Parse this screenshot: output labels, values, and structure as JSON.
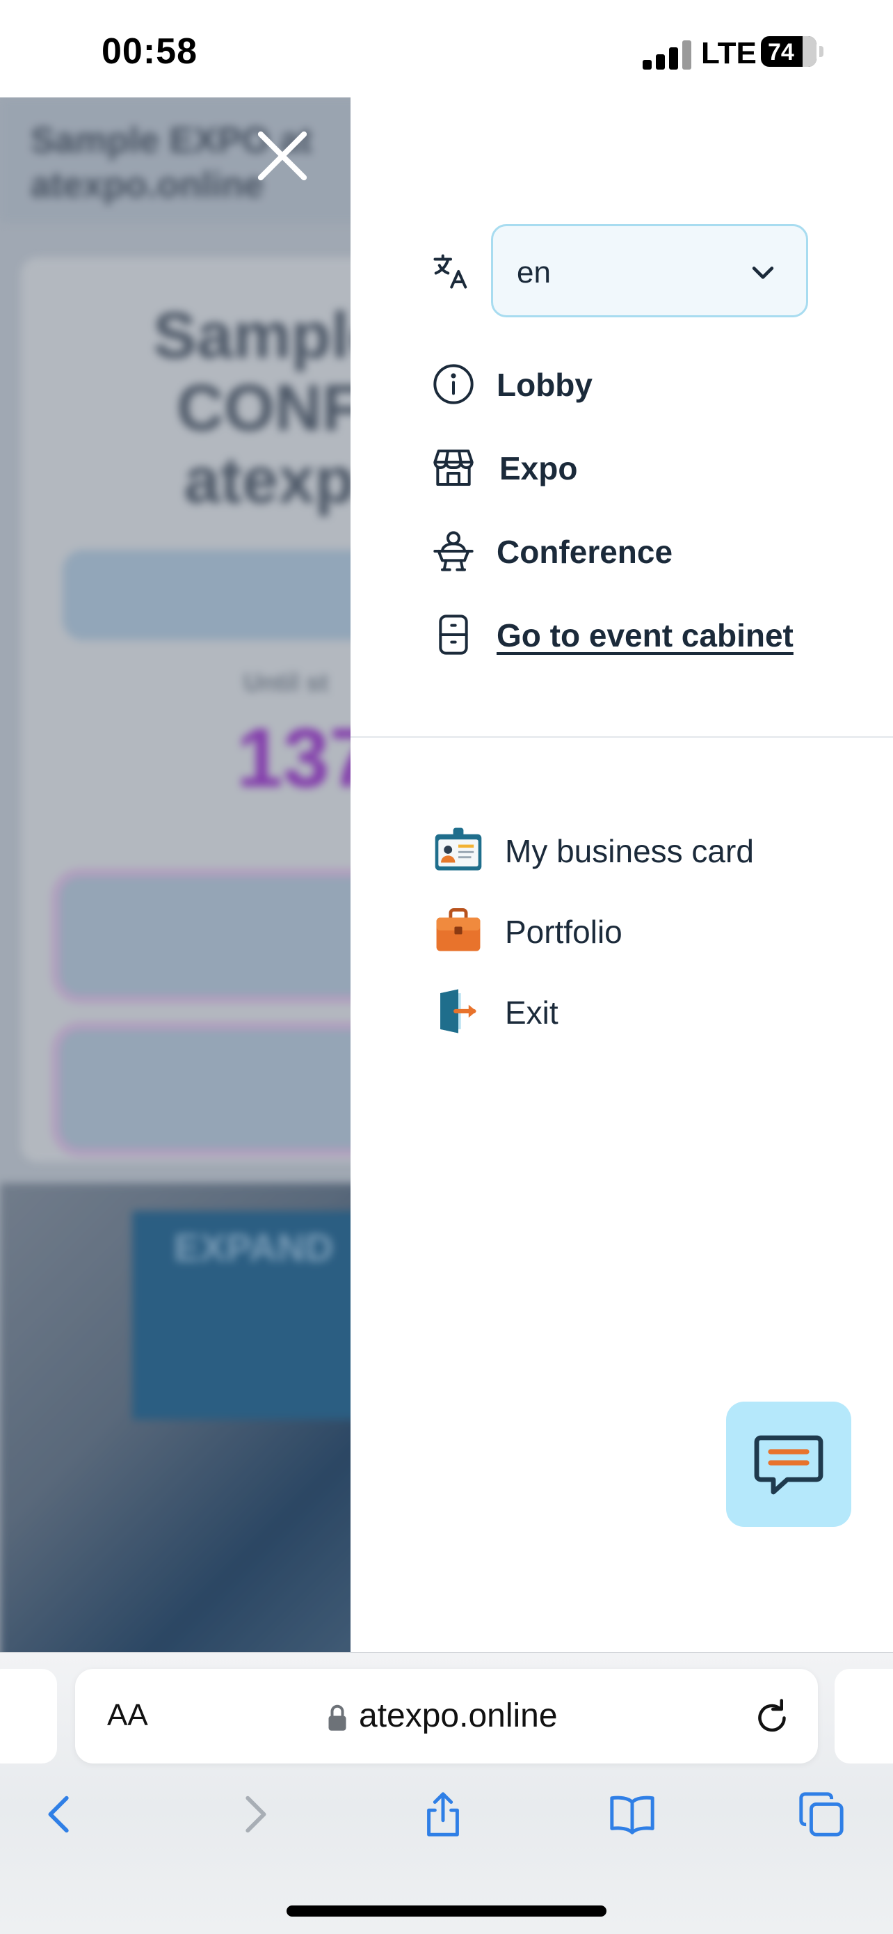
{
  "status_bar": {
    "time": "00:58",
    "network": "LTE",
    "battery": "74"
  },
  "background_page": {
    "header_text": "Sample EXPO at\natexpo.online",
    "title": "Sample\nCONF\natexp",
    "countdown_label": "Until st",
    "countdown_value": "137",
    "banner_text": "EXPAND"
  },
  "menu": {
    "language": {
      "selected": "en",
      "icon": "translate-icon"
    },
    "nav": [
      {
        "label": "Lobby",
        "icon": "info-circle-icon"
      },
      {
        "label": "Expo",
        "icon": "store-icon"
      },
      {
        "label": "Conference",
        "icon": "speaker-podium-icon"
      },
      {
        "label": "Go to event cabinet",
        "icon": "cabinet-icon",
        "is_link": true
      }
    ],
    "secondary": [
      {
        "label": "My business card",
        "icon": "id-card-icon"
      },
      {
        "label": "Portfolio",
        "icon": "briefcase-icon"
      },
      {
        "label": "Exit",
        "icon": "exit-door-icon"
      }
    ]
  },
  "browser": {
    "aa_label": "AA",
    "url": "atexpo.online"
  },
  "colors": {
    "accent_border": "#a8dcf0",
    "chat_fab_bg": "#b5e8fb",
    "countdown": "#a63fd4",
    "text": "#1b2a3a"
  }
}
